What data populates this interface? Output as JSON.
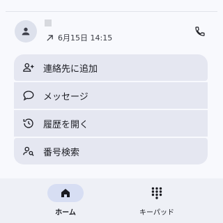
{
  "contact": {
    "name": "",
    "call_direction_icon": "outgoing-call-arrow-icon",
    "call_time": "6月15日 14:15",
    "avatar_icon": "person-icon",
    "call_button_icon": "phone-icon"
  },
  "actions": [
    {
      "label": "連絡先に追加",
      "icon": "add-person-icon"
    },
    {
      "label": "メッセージ",
      "icon": "message-bubble-icon"
    },
    {
      "label": "履歴を開く",
      "icon": "history-icon"
    },
    {
      "label": "番号検索",
      "icon": "person-search-icon"
    }
  ],
  "bottom_nav": {
    "home_label": "ホーム",
    "keypad_label": "キーパッド",
    "active": "home"
  },
  "colors": {
    "action_bg": "#e5e7f1",
    "nav_active_pill": "#d7def3",
    "card_bg": "#f8f9fd"
  }
}
